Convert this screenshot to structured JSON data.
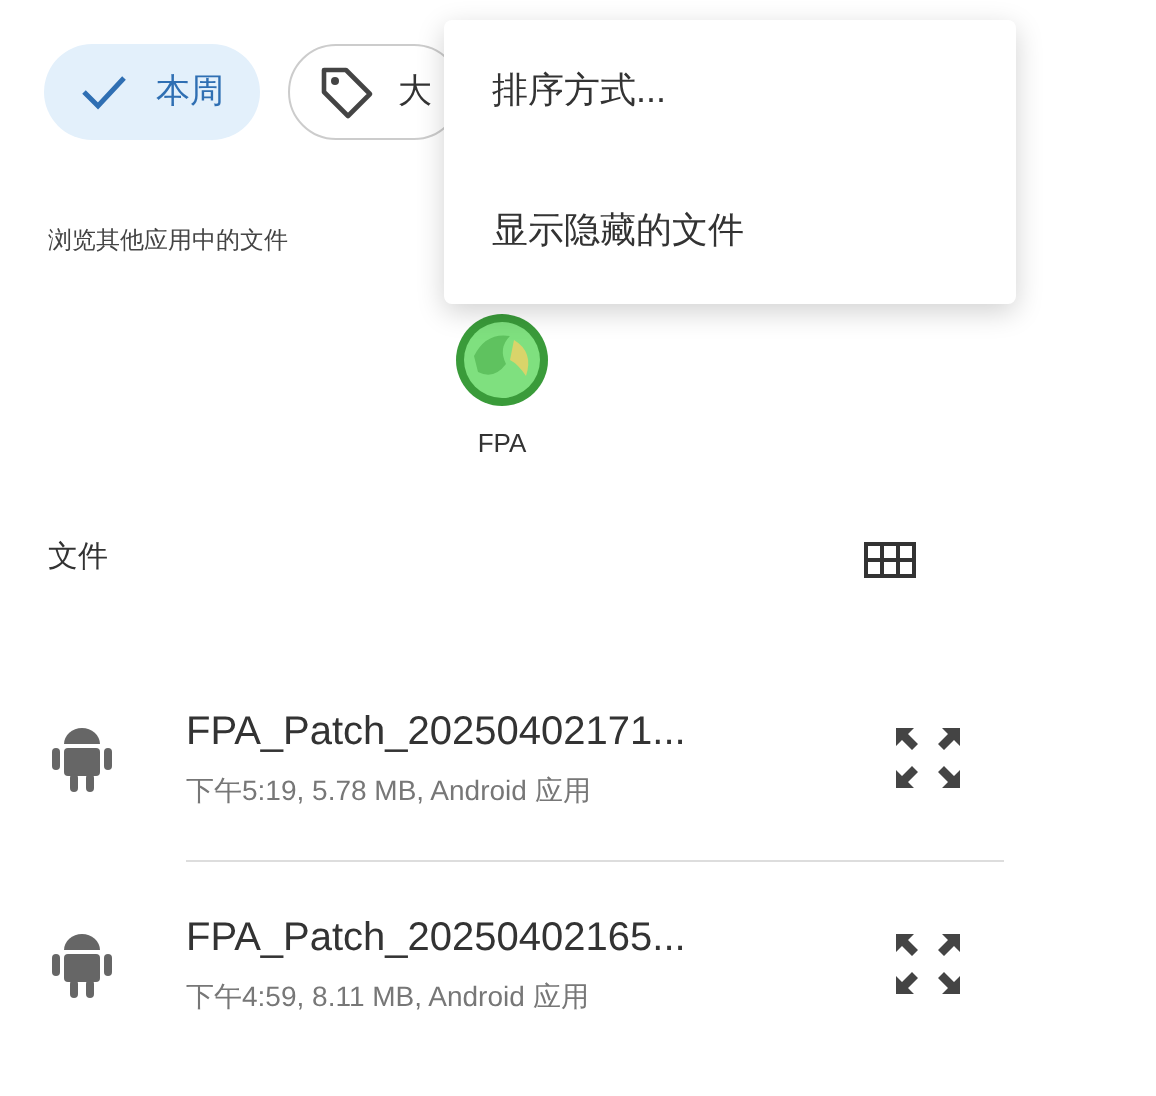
{
  "filter_chips": [
    {
      "label": "本周",
      "selected": true,
      "kind": "check"
    },
    {
      "label": "大",
      "selected": false,
      "kind": "tag"
    }
  ],
  "menu": {
    "items": [
      "排序方式...",
      "显示隐藏的文件"
    ]
  },
  "other_apps": {
    "heading": "浏览其他应用中的文件",
    "apps": [
      {
        "label": "FPA"
      }
    ]
  },
  "files": {
    "heading": "文件",
    "rows": [
      {
        "name": "FPA_Patch_20250402171...",
        "details": "下午5:19, 5.78 MB, Android 应用"
      },
      {
        "name": "FPA_Patch_20250402165...",
        "details": "下午4:59, 8.11 MB, Android 应用"
      }
    ]
  }
}
